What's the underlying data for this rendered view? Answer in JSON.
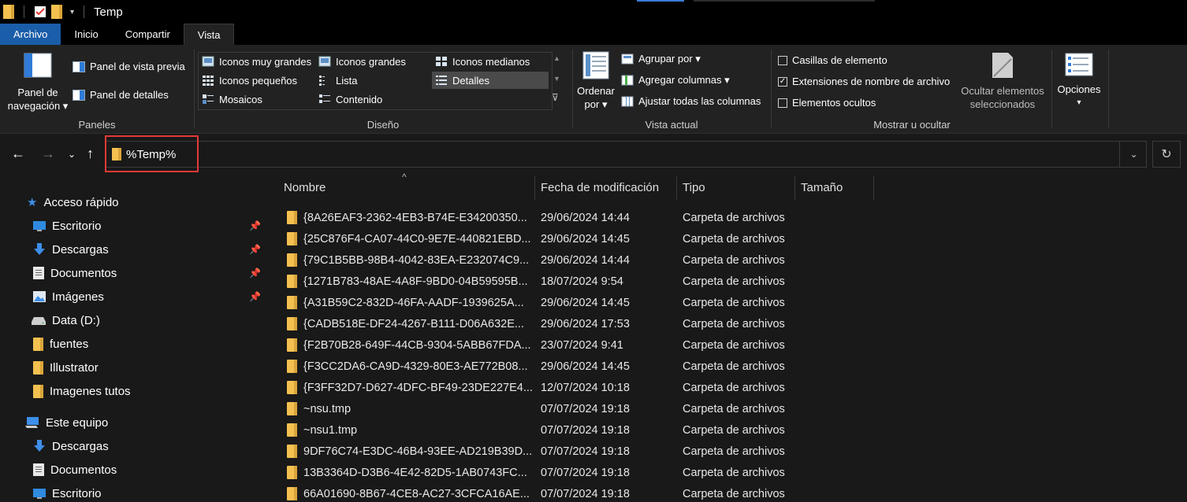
{
  "titlebar": {
    "title": "Temp"
  },
  "tabs": [
    {
      "label": "Archivo"
    },
    {
      "label": "Inicio"
    },
    {
      "label": "Compartir"
    },
    {
      "label": "Vista"
    }
  ],
  "ribbon": {
    "panes": {
      "nav_pane_line1": "Panel de",
      "nav_pane_line2": "navegación",
      "preview_pane": "Panel de vista previa",
      "details_pane": "Panel de detalles",
      "group_label": "Paneles"
    },
    "layout": {
      "items": [
        "Iconos muy grandes",
        "Iconos grandes",
        "Iconos medianos",
        "Iconos pequeños",
        "Lista",
        "Detalles",
        "Mosaicos",
        "Contenido"
      ],
      "selected": "Detalles",
      "group_label": "Diseño"
    },
    "current_view": {
      "sort_line1": "Ordenar",
      "sort_line2": "por",
      "group_by": "Agrupar por",
      "add_columns": "Agregar columnas",
      "fit_columns": "Ajustar todas las columnas",
      "group_label": "Vista actual"
    },
    "show_hide": {
      "item_checkboxes": "Casillas de elemento",
      "file_extensions": "Extensiones de nombre de archivo",
      "hidden_items": "Elementos ocultos",
      "item_checkboxes_checked": false,
      "file_extensions_checked": true,
      "hidden_items_checked": false,
      "hide_selected_line1": "Ocultar elementos",
      "hide_selected_line2": "seleccionados",
      "group_label": "Mostrar u ocultar"
    },
    "options": {
      "label": "Opciones"
    }
  },
  "address": {
    "value": "%Temp%",
    "highlight_color": "#e53935"
  },
  "sidebar": {
    "quick_access": "Acceso rápido",
    "quick_items": [
      {
        "label": "Escritorio",
        "pinned": true
      },
      {
        "label": "Descargas",
        "pinned": true
      },
      {
        "label": "Documentos",
        "pinned": true
      },
      {
        "label": "Imágenes",
        "pinned": true
      },
      {
        "label": "Data (D:)",
        "pinned": false
      },
      {
        "label": "fuentes",
        "pinned": false
      },
      {
        "label": "Illustrator",
        "pinned": false
      },
      {
        "label": "Imagenes tutos",
        "pinned": false
      }
    ],
    "this_pc": "Este equipo",
    "pc_items": [
      {
        "label": "Descargas"
      },
      {
        "label": "Documentos"
      },
      {
        "label": "Escritorio"
      }
    ]
  },
  "columns": {
    "name": "Nombre",
    "date": "Fecha de modificación",
    "type": "Tipo",
    "size": "Tamaño"
  },
  "files": [
    {
      "name": "{8A26EAF3-2362-4EB3-B74E-E34200350...",
      "date": "29/06/2024 14:44",
      "type": "Carpeta de archivos"
    },
    {
      "name": "{25C876F4-CA07-44C0-9E7E-440821EBD...",
      "date": "29/06/2024 14:45",
      "type": "Carpeta de archivos"
    },
    {
      "name": "{79C1B5BB-98B4-4042-83EA-E232074C9...",
      "date": "29/06/2024 14:44",
      "type": "Carpeta de archivos"
    },
    {
      "name": "{1271B783-48AE-4A8F-9BD0-04B59595B...",
      "date": "18/07/2024 9:54",
      "type": "Carpeta de archivos"
    },
    {
      "name": "{A31B59C2-832D-46FA-AADF-1939625A...",
      "date": "29/06/2024 14:45",
      "type": "Carpeta de archivos"
    },
    {
      "name": "{CADB518E-DF24-4267-B111-D06A632E...",
      "date": "29/06/2024 17:53",
      "type": "Carpeta de archivos"
    },
    {
      "name": "{F2B70B28-649F-44CB-9304-5ABB67FDA...",
      "date": "23/07/2024 9:41",
      "type": "Carpeta de archivos"
    },
    {
      "name": "{F3CC2DA6-CA9D-4329-80E3-AE772B08...",
      "date": "29/06/2024 14:45",
      "type": "Carpeta de archivos"
    },
    {
      "name": "{F3FF32D7-D627-4DFC-BF49-23DE227E4...",
      "date": "12/07/2024 10:18",
      "type": "Carpeta de archivos"
    },
    {
      "name": "~nsu.tmp",
      "date": "07/07/2024 19:18",
      "type": "Carpeta de archivos"
    },
    {
      "name": "~nsu1.tmp",
      "date": "07/07/2024 19:18",
      "type": "Carpeta de archivos"
    },
    {
      "name": "9DF76C74-E3DC-46B4-93EE-AD219B39D...",
      "date": "07/07/2024 19:18",
      "type": "Carpeta de archivos"
    },
    {
      "name": "13B3364D-D3B6-4E42-82D5-1AB0743FC...",
      "date": "07/07/2024 19:18",
      "type": "Carpeta de archivos"
    },
    {
      "name": "66A01690-8B67-4CE8-AC27-3CFCA16AE...",
      "date": "07/07/2024 19:18",
      "type": "Carpeta de archivos"
    }
  ]
}
